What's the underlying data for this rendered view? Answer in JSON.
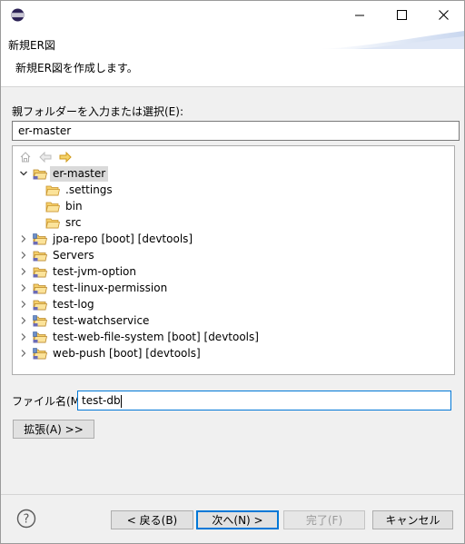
{
  "window": {
    "minimize_glyph": "—",
    "maximize_glyph": "☐",
    "close_glyph": "✕"
  },
  "header": {
    "title": "新規ER図",
    "description": "新規ER図を作成します。"
  },
  "folder": {
    "label": "親フォルダーを入力または選択(E):",
    "value": "er-master"
  },
  "tree": {
    "items": [
      {
        "label": "er-master",
        "level": 0,
        "expanded": true,
        "selected": true,
        "type": "project-open"
      },
      {
        "label": ".settings",
        "level": 1,
        "type": "folder"
      },
      {
        "label": "bin",
        "level": 1,
        "type": "folder"
      },
      {
        "label": "src",
        "level": 1,
        "type": "folder"
      },
      {
        "label": "jpa-repo [boot] [devtools]",
        "level": 0,
        "type": "project-java"
      },
      {
        "label": "Servers",
        "level": 0,
        "type": "project"
      },
      {
        "label": "test-jvm-option",
        "level": 0,
        "type": "project"
      },
      {
        "label": "test-linux-permission",
        "level": 0,
        "type": "project"
      },
      {
        "label": "test-log",
        "level": 0,
        "type": "project"
      },
      {
        "label": "test-watchservice",
        "level": 0,
        "type": "project-java"
      },
      {
        "label": "test-web-file-system [boot] [devtools]",
        "level": 0,
        "type": "project-java"
      },
      {
        "label": "web-push [boot] [devtools]",
        "level": 0,
        "type": "project-java"
      }
    ]
  },
  "filename": {
    "label": "ファイル名(M):",
    "value": "test-db"
  },
  "buttons": {
    "advanced": "拡張(A) >>",
    "back": "< 戻る(B)",
    "next": "次へ(N) >",
    "finish": "完了(F)",
    "cancel": "キャンセル"
  },
  "colors": {
    "accent": "#0078d7",
    "folder": "#e8b64c",
    "arrow": "#e0a526"
  }
}
